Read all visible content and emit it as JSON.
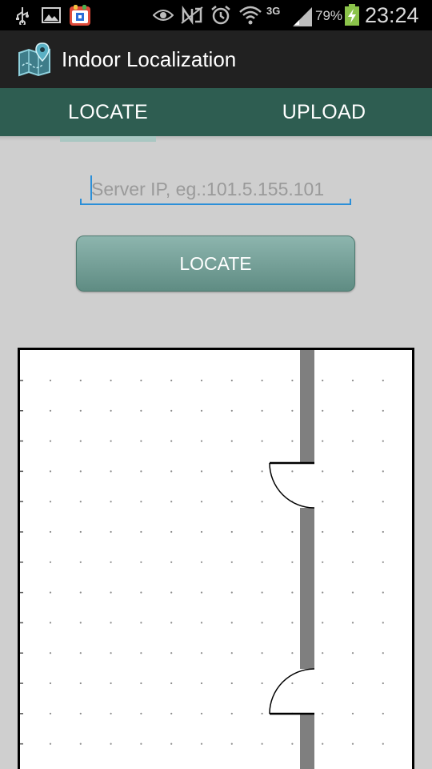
{
  "status_bar": {
    "battery_percent": "79%",
    "network_type": "3G",
    "time": "23:24",
    "icons": [
      "usb-icon",
      "gallery-icon",
      "app-notification-icon",
      "eye-icon",
      "nfc-icon",
      "alarm-icon",
      "wifi-icon",
      "signal-icon",
      "battery-charging-icon"
    ]
  },
  "action_bar": {
    "title": "Indoor Localization",
    "icon": "map-pin-icon"
  },
  "tabs": [
    {
      "label": "LOCATE",
      "selected": true
    },
    {
      "label": "UPLOAD",
      "selected": false
    }
  ],
  "server_input": {
    "value": "",
    "placeholder": "Server IP, eg.:101.5.155.101"
  },
  "locate_button": {
    "label": "LOCATE"
  },
  "colors": {
    "tab_bar": "#2e5d51",
    "tab_indicator": "#a9c7c2",
    "input_accent": "#2b8fd8",
    "button": "#78a39b",
    "background": "#cfcfcf",
    "status_bar": "#000000",
    "action_bar": "#212121"
  }
}
